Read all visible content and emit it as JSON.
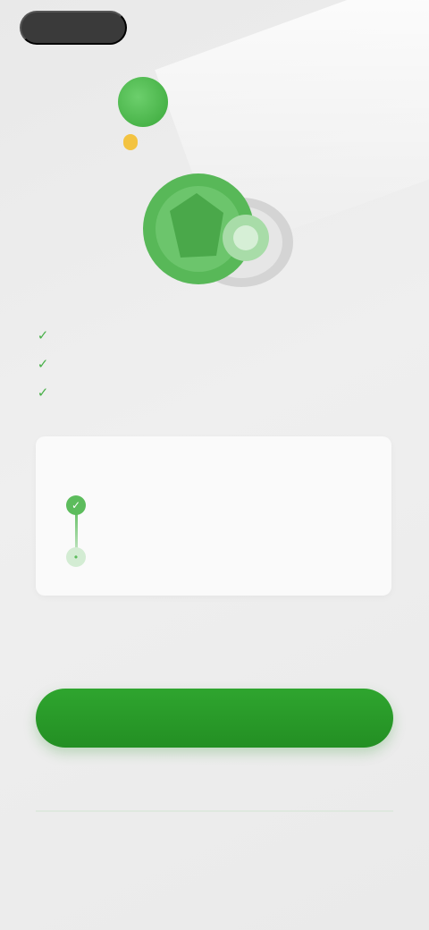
{
  "topbar": {
    "left_button": "",
    "right_link": ""
  },
  "brand": {
    "logo_letter": "",
    "name": "",
    "badge": ""
  },
  "features": [
    {
      "icon": "check-icon",
      "text": ""
    },
    {
      "icon": "check-icon",
      "text": ""
    },
    {
      "icon": "check-icon",
      "text": ""
    }
  ],
  "card": {
    "title": "",
    "steps": [
      {
        "title": "",
        "desc": ""
      },
      {
        "title": "",
        "desc": ""
      }
    ]
  },
  "note": "",
  "cta": {
    "label": ""
  },
  "links": {
    "plans": "",
    "restore": "",
    "terms": ""
  },
  "colors": {
    "accent": "#2fa52f",
    "brand_green": "#4cb84c",
    "badge": "#f3c341",
    "dark_pill": "#3a3a3a"
  }
}
